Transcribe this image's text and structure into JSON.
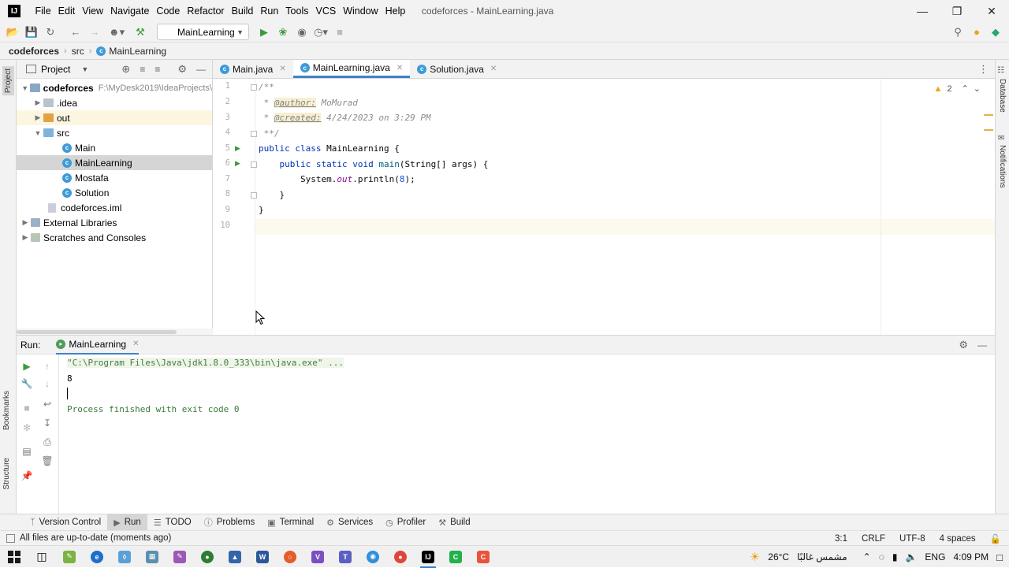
{
  "window": {
    "title": "codeforces - MainLearning.java",
    "menu": [
      "File",
      "Edit",
      "View",
      "Navigate",
      "Code",
      "Refactor",
      "Build",
      "Run",
      "Tools",
      "VCS",
      "Window",
      "Help"
    ]
  },
  "toolbar": {
    "run_config": "MainLearning"
  },
  "breadcrumb": [
    "codeforces",
    "src",
    "MainLearning"
  ],
  "project_panel": {
    "title": "Project",
    "tree": [
      {
        "label": "codeforces",
        "path": "F:\\MyDesk2019\\IdeaProjects\\"
      },
      {
        "label": ".idea"
      },
      {
        "label": "out"
      },
      {
        "label": "src"
      },
      {
        "label": "Main"
      },
      {
        "label": "MainLearning"
      },
      {
        "label": "Mostafa"
      },
      {
        "label": "Solution"
      },
      {
        "label": "codeforces.iml"
      },
      {
        "label": "External Libraries"
      },
      {
        "label": "Scratches and Consoles"
      }
    ]
  },
  "editor": {
    "tabs": [
      "Main.java",
      "MainLearning.java",
      "Solution.java"
    ],
    "line_numbers": [
      "1",
      "2",
      "3",
      "4",
      "5",
      "6",
      "7",
      "8",
      "9",
      "10"
    ],
    "code": {
      "l1": "/**",
      "l2_star": " * ",
      "l2_tag": "@author:",
      "l2_val": " MoMurad",
      "l3_star": " * ",
      "l3_tag": "@created:",
      "l3_val": " 4/24/2023 on 3:29 PM",
      "l4": " **/",
      "l5_kw": "public class",
      "l5_rest": " MainLearning {",
      "l6_kw": "    public static void",
      "l6_fn": " main",
      "l6_rest": "(String[] args) {",
      "l7_a": "        System.",
      "l7_out": "out",
      "l7_b": ".println(",
      "l7_num": "8",
      "l7_c": ");",
      "l8": "    }",
      "l9": "}"
    },
    "warnings_count": "2"
  },
  "run_panel": {
    "label": "Run:",
    "tab": "MainLearning",
    "console": {
      "command": "\"C:\\Program Files\\Java\\jdk1.8.0_333\\bin\\java.exe\" ...",
      "output": "8",
      "finished": "Process finished with exit code 0"
    }
  },
  "side_tabs": {
    "left": [
      "Project",
      "Bookmarks",
      "Structure"
    ],
    "right": [
      "Database",
      "Notifications"
    ]
  },
  "bottom_tabs": [
    "Version Control",
    "Run",
    "TODO",
    "Problems",
    "Terminal",
    "Services",
    "Profiler",
    "Build"
  ],
  "status": {
    "message": "All files are up-to-date (moments ago)",
    "position": "3:1",
    "line_sep": "CRLF",
    "encoding": "UTF-8",
    "indent": "4 spaces"
  },
  "taskbar": {
    "weather": "26°C",
    "weather_text": "مشمس غالبًا",
    "lang": "ENG",
    "time": "4:09 PM"
  }
}
